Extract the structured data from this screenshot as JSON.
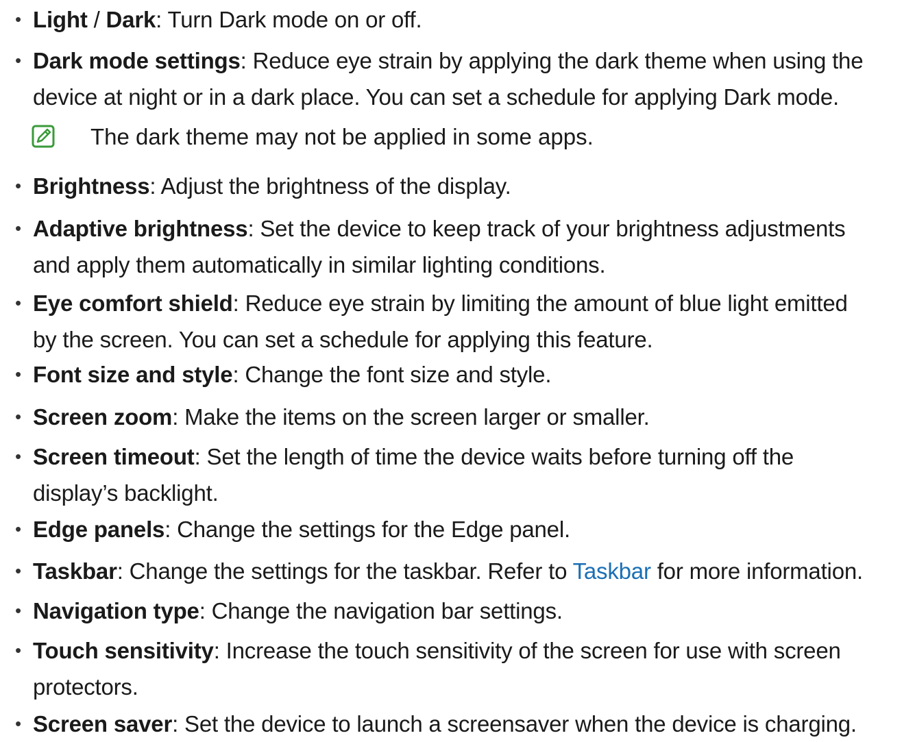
{
  "items": [
    {
      "term_a": "Light",
      "sep": " / ",
      "term_b": "Dark",
      "desc": ": Turn Dark mode on or off."
    },
    {
      "term": "Dark mode settings",
      "line1": ": Reduce eye strain by applying the dark theme when using the",
      "line2": "device at night or in a dark place. You can set a schedule for applying Dark mode."
    },
    {
      "term": "Brightness",
      "desc": ": Adjust the brightness of the display."
    },
    {
      "term": "Adaptive brightness",
      "line1": ": Set the device to keep track of your brightness adjustments",
      "line2": "and apply them automatically in similar lighting conditions."
    },
    {
      "term": "Eye comfort shield",
      "line1": ": Reduce eye strain by limiting the amount of blue light emitted",
      "line2": "by the screen. You can set a schedule for applying this feature."
    },
    {
      "term": "Font size and style",
      "desc": ": Change the font size and style."
    },
    {
      "term": "Screen zoom",
      "desc": ": Make the items on the screen larger or smaller."
    },
    {
      "term": "Screen timeout",
      "line1": ": Set the length of time the device waits before turning off the",
      "line2": "display’s backlight."
    },
    {
      "term": "Edge panels",
      "desc": ": Change the settings for the Edge panel."
    },
    {
      "term": "Taskbar",
      "desc_pre": ": Change the settings for the taskbar. Refer to ",
      "link": "Taskbar",
      "desc_post": " for more information."
    },
    {
      "term": "Navigation type",
      "desc": ": Change the navigation bar settings."
    },
    {
      "term": "Touch sensitivity",
      "line1": ": Increase the touch sensitivity of the screen for use with screen",
      "line2": "protectors."
    },
    {
      "term": "Screen saver",
      "desc": ": Set the device to launch a screensaver when the device is charging."
    }
  ],
  "note": {
    "text": "The dark theme may not be applied in some apps.",
    "icon": "note-pencil-icon",
    "icon_color": "#3a9a3a"
  },
  "bullet_char": "•",
  "colors": {
    "text": "#1a1a1a",
    "link": "#1a6fb5"
  }
}
